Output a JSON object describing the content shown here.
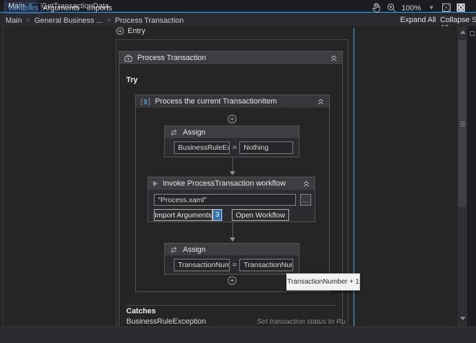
{
  "window": {
    "tabs": [
      {
        "label": "Main",
        "close": "×"
      },
      {
        "label": "GetTransactionData"
      }
    ],
    "overflow_caret": "▾"
  },
  "breadcrumb": {
    "sep": ">",
    "items": [
      "Main",
      "General Business ...",
      "Process Transaction"
    ],
    "expand_all": "Expand All",
    "collapse_all": "Collapse All",
    "edge_letter": "S"
  },
  "designer": {
    "entry_label": "Entry",
    "state_title": "Process Transaction",
    "try_label": "Try",
    "sequence_title": "Process the current TransactionItem",
    "assign1": {
      "title": "Assign",
      "to": "BusinessRuleExcep",
      "eq": "=",
      "value": "Nothing"
    },
    "invoke": {
      "title": "Invoke ProcessTransaction workflow",
      "path": "\"Process.xaml\"",
      "browse": "...",
      "import_arguments": "Import Arguments",
      "arguments_count": "3",
      "open_workflow": "Open Workflow"
    },
    "assign2": {
      "title": "Assign",
      "to": "TransactionNumbe",
      "eq": "=",
      "value": "TransactionNumbe"
    },
    "tooltip": "TransactionNumber + 1",
    "catches_label": "Catches",
    "catch_type": "BusinessRuleException",
    "catch_hint": "Set transaction status to Ru"
  },
  "bottom_bar": {
    "variables": "Variables",
    "arguments": "Arguments",
    "imports": "Imports",
    "zoom_level": "100%",
    "zoom_caret": "▾"
  },
  "colors": {
    "accent_blue": "#2d6ca2",
    "selection_line": "#3a6c8f",
    "variables_blue": "#4ea3e0",
    "badge_blue": "#3572b0",
    "tooltip_bg": "#f2f2f2",
    "canvas_bg": "#252526"
  }
}
